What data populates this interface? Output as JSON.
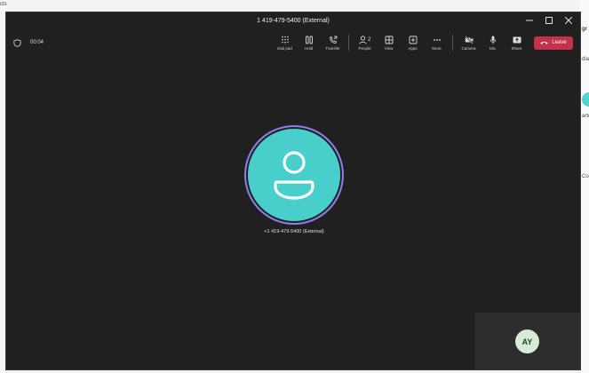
{
  "window": {
    "title": "1 419-479-5400 (External)"
  },
  "toolbar": {
    "timer": "00:04",
    "buttons": [
      {
        "label": "Dial pad",
        "icon": "dialpad-icon"
      },
      {
        "label": "Hold",
        "icon": "hold-icon"
      },
      {
        "label": "Transfer",
        "icon": "transfer-icon"
      },
      {
        "label": "People",
        "icon": "people-icon",
        "badge": "2"
      },
      {
        "label": "View",
        "icon": "view-icon"
      },
      {
        "label": "Apps",
        "icon": "apps-icon"
      },
      {
        "label": "More",
        "icon": "more-icon"
      },
      {
        "label": "Camera",
        "icon": "camera-off-icon"
      },
      {
        "label": "Mic",
        "icon": "mic-icon"
      },
      {
        "label": "Share",
        "icon": "share-icon"
      }
    ],
    "leave_label": "Leave"
  },
  "call": {
    "caller_name": "+1 419-479-5400 (External)"
  },
  "self_view": {
    "initials": "AY"
  },
  "background": {
    "left_text": "cts",
    "right_text_1": "gr",
    "right_text_2": "dia",
    "right_text_3": "arte",
    "right_text_4": "Co"
  },
  "colors": {
    "leave": "#c4314b",
    "avatar": "#48cfcb",
    "ring": "#8e7cf0",
    "window_bg": "#202020"
  }
}
